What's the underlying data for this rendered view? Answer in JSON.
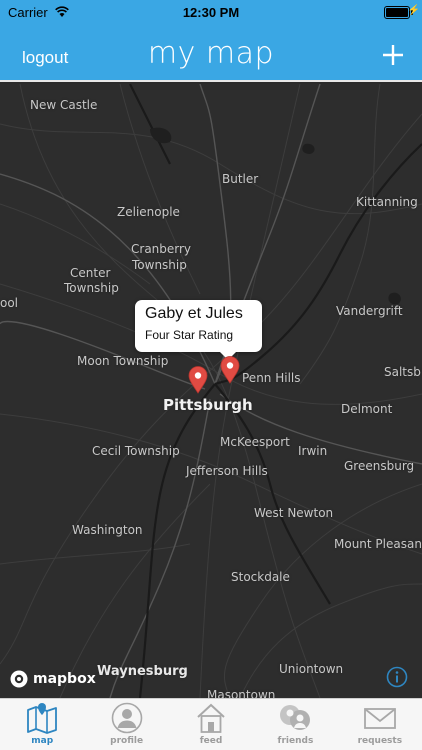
{
  "status_bar": {
    "carrier": "Carrier",
    "time": "12:30 PM"
  },
  "nav": {
    "logout_label": "logout",
    "title": "my map",
    "add_label": "+"
  },
  "map": {
    "places": [
      "New Castle",
      "Butler",
      "Kittanning",
      "Zelienople",
      "Cranberry",
      "Township",
      "Center",
      "Township",
      "Vandergrift",
      "Moon Township",
      "Penn Hills",
      "Saltsb",
      "Pittsburgh",
      "Delmont",
      "McKeesport",
      "Cecil Township",
      "Irwin",
      "Jefferson Hills",
      "Greensburg",
      "West Newton",
      "Washington",
      "Mount Pleasant",
      "Stockdale",
      "Waynesburg",
      "Uniontown",
      "Masontown",
      "ool"
    ],
    "callout": {
      "title": "Gaby et Jules",
      "subtitle": "Four Star Rating"
    },
    "pin_color": "#e04b43",
    "attribution": "mapbox"
  },
  "tabs": [
    {
      "label": "map",
      "icon": "map-icon",
      "active": true
    },
    {
      "label": "profile",
      "icon": "profile-icon",
      "active": false
    },
    {
      "label": "feed",
      "icon": "home-icon",
      "active": false
    },
    {
      "label": "friends",
      "icon": "friends-icon",
      "active": false
    },
    {
      "label": "requests",
      "icon": "envelope-icon",
      "active": false
    }
  ],
  "colors": {
    "accent": "#3aa7e4",
    "tab_active": "#2e86c1",
    "map_bg": "#2d2d2d"
  }
}
